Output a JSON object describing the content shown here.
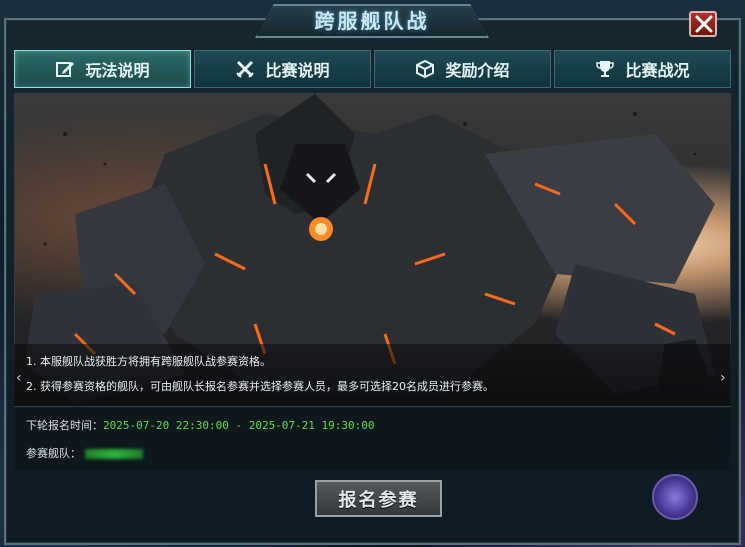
{
  "window": {
    "title": "跨服舰队战"
  },
  "tabs": [
    {
      "label": "玩法说明",
      "icon": "edit-icon",
      "active": true
    },
    {
      "label": "比赛说明",
      "icon": "crossed-swords-icon",
      "active": false
    },
    {
      "label": "奖励介绍",
      "icon": "cube-icon",
      "active": false
    },
    {
      "label": "比赛战况",
      "icon": "trophy-icon",
      "active": false
    }
  ],
  "description": [
    "1. 本服舰队战获胜方将拥有跨服舰队战参赛资格。",
    "2. 获得参赛资格的舰队，可由舰队长报名参赛并选择参赛人员，最多可选择20名成员进行参赛。"
  ],
  "signup": {
    "time_label": "下轮报名时间：",
    "time_value": "2025-07-20 22:30:00 - 2025-07-21 19:30:00",
    "team_label": "参赛舰队："
  },
  "actions": {
    "signup_button": "报名参赛"
  },
  "colors": {
    "accent": "#8ee0d6",
    "time_text": "#56e04a",
    "close_bg": "#b0312b"
  }
}
